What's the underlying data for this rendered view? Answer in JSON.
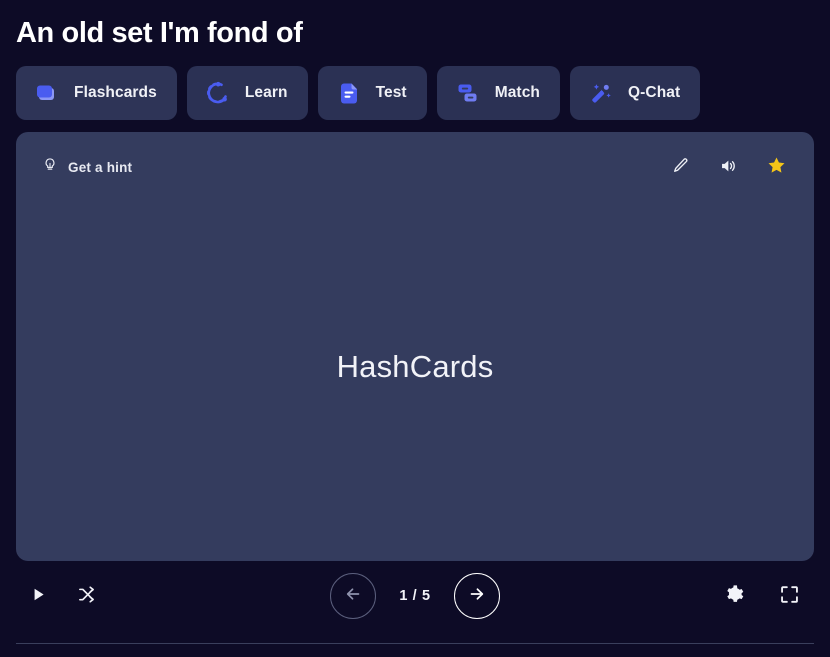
{
  "header": {
    "title": "An old set I'm fond of"
  },
  "tabs": [
    {
      "id": "flashcards",
      "label": "Flashcards",
      "icon": "flashcards-icon",
      "active": true
    },
    {
      "id": "learn",
      "label": "Learn",
      "icon": "learn-icon",
      "active": false
    },
    {
      "id": "test",
      "label": "Test",
      "icon": "test-icon",
      "active": false
    },
    {
      "id": "match",
      "label": "Match",
      "icon": "match-icon",
      "active": false
    },
    {
      "id": "qchat",
      "label": "Q-Chat",
      "icon": "magic-wand-icon",
      "active": false
    }
  ],
  "card": {
    "hint_label": "Get a hint",
    "hint_icon": "lightbulb-icon",
    "term": "HashCards",
    "actions": [
      {
        "id": "edit",
        "icon": "pencil-icon",
        "title": "Edit"
      },
      {
        "id": "audio",
        "icon": "speaker-icon",
        "title": "Play audio"
      },
      {
        "id": "star",
        "icon": "star-icon",
        "title": "Star",
        "starred": true
      }
    ]
  },
  "controls": {
    "play_label": "Play",
    "shuffle_label": "Shuffle",
    "prev_label": "Previous card",
    "next_label": "Next card",
    "counter": "1 / 5",
    "current_index": 1,
    "total": 5,
    "settings_label": "Settings",
    "fullscreen_label": "Fullscreen"
  },
  "colors": {
    "page_background": "#0d0b26",
    "card_background": "#343c5e",
    "tab_background": "#2b3154",
    "accent_blue": "#4a5cf0",
    "icon_blue": "#4f61ee",
    "star_gold": "#f5c518",
    "text_primary": "#ffffff",
    "divider": "#3a3f5c"
  }
}
